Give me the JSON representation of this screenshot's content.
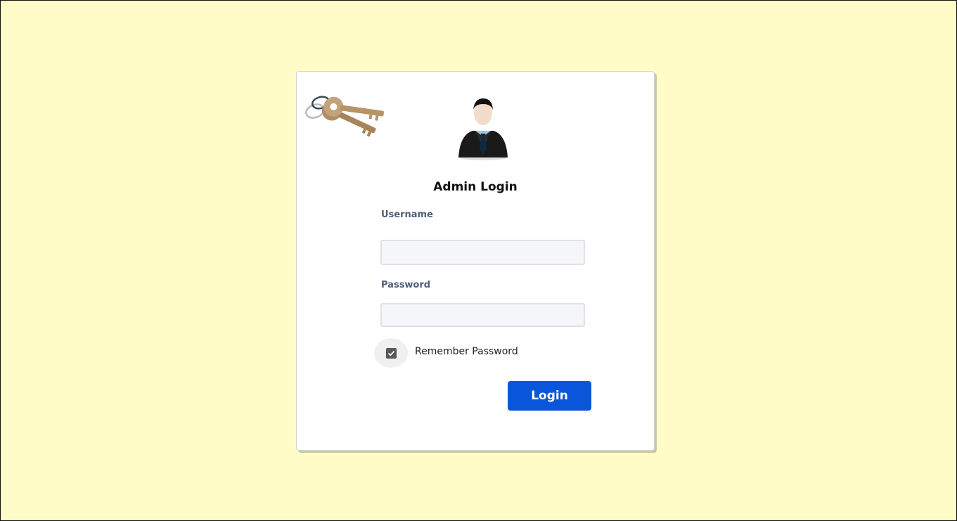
{
  "app": {
    "background_color": "#fffcc8"
  },
  "card": {
    "title": "Admin Login",
    "icons": {
      "keys": "keys-icon",
      "avatar": "user-avatar-icon"
    }
  },
  "form": {
    "username_label": "Username",
    "username_value": "",
    "username_placeholder": "",
    "password_label": "Password",
    "password_value": "",
    "password_placeholder": "",
    "remember_label": "Remember Password",
    "remember_checked": true,
    "login_label": "Login",
    "login_color": "#0a56db"
  }
}
